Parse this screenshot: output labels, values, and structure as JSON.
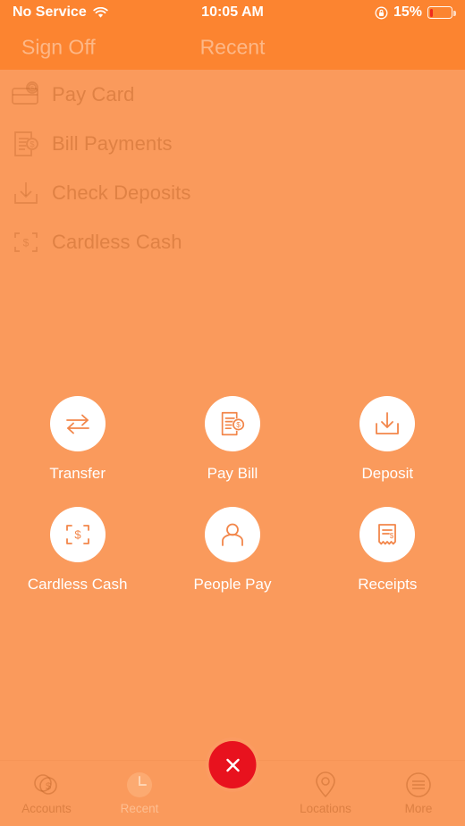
{
  "status_bar": {
    "carrier": "No Service",
    "wifi_icon": "wifi-icon",
    "time": "10:05 AM",
    "orientation_lock_icon": "rotation-lock-icon",
    "battery_percent": "15%",
    "battery_icon": "battery-icon"
  },
  "nav_bar": {
    "sign_off_label": "Sign Off",
    "title": "Recent"
  },
  "menu_list": {
    "items": [
      {
        "label": "Pay Card",
        "icon": "credit-card-coin-icon"
      },
      {
        "label": "Bill Payments",
        "icon": "document-coin-icon"
      },
      {
        "label": "Check Deposits",
        "icon": "download-tray-icon"
      },
      {
        "label": "Cardless Cash",
        "icon": "scan-dollar-icon"
      }
    ]
  },
  "action_grid": {
    "rows": [
      [
        {
          "label": "Transfer",
          "icon": "transfer-arrows-icon"
        },
        {
          "label": "Pay Bill",
          "icon": "document-coin-icon"
        },
        {
          "label": "Deposit",
          "icon": "download-tray-icon"
        }
      ],
      [
        {
          "label": "Cardless Cash",
          "icon": "scan-dollar-icon"
        },
        {
          "label": "People Pay",
          "icon": "person-icon"
        },
        {
          "label": "Receipts",
          "icon": "receipt-icon"
        }
      ]
    ]
  },
  "tab_bar": {
    "tabs": [
      {
        "label": "Accounts",
        "icon": "coins-dollar-icon",
        "active": false
      },
      {
        "label": "Recent",
        "icon": "clock-icon",
        "active": true
      }
    ],
    "close_button": {
      "icon": "close-x-icon",
      "color": "#E8121E"
    },
    "tabs_right": [
      {
        "label": "Locations",
        "icon": "map-pin-icon",
        "active": false
      },
      {
        "label": "More",
        "icon": "hamburger-circle-icon",
        "active": false
      }
    ]
  },
  "colors": {
    "body_background": "#FA9A5C",
    "bar_background": "#FC8430",
    "accent_icon": "#F2864A",
    "close_red": "#E8121E",
    "battery_red": "#F02B1D"
  }
}
